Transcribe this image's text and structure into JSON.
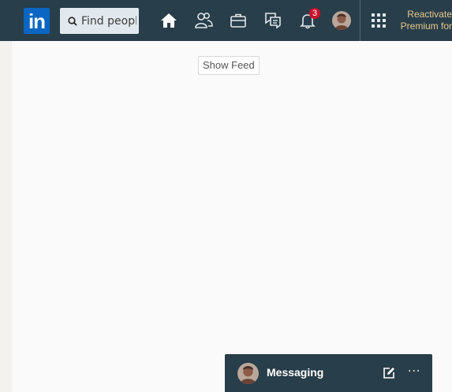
{
  "topbar": {
    "logo_text": "in",
    "search": {
      "placeholder": "Find people"
    },
    "nav_icons": [
      "home-icon",
      "my-network-icon",
      "jobs-icon",
      "messaging-icon",
      "notifications-icon",
      "profile-avatar",
      "work-grid-icon"
    ],
    "notifications_count": "3",
    "premium_line1": "Reactivate",
    "premium_line2": "Premium for"
  },
  "main": {
    "show_feed_label": "Show Feed"
  },
  "messaging": {
    "title": "Messaging",
    "more_label": "···"
  },
  "colors": {
    "topbar_bg": "#283e4a",
    "brand_blue": "#0a66c2",
    "badge_red": "#cb112d",
    "premium_gold": "#e8c98d"
  }
}
